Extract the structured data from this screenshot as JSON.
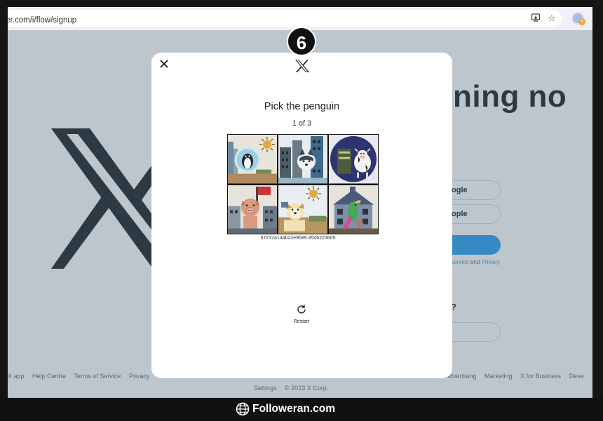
{
  "browser": {
    "url": "ter.com/i/flow/signup",
    "icons": [
      "install-icon",
      "star-icon",
      "extension-icon",
      "menu-icon"
    ],
    "profile_badge": "8"
  },
  "background_page": {
    "headline": "ening no",
    "buttons": [
      "ogle",
      "ople"
    ],
    "terms_prefix": "Service",
    "terms_and": "and",
    "terms_privacy": "Privacy",
    "question": "?",
    "footer_row1": [
      "X app",
      "Help Centre",
      "Terms of Service",
      "Privacy",
      "Advertising",
      "Marketing",
      "X for Business",
      "Deve"
    ],
    "footer_row2": [
      "Settings",
      "© 2023 X Corp."
    ]
  },
  "modal": {
    "title": "Pick the penguin",
    "counter": "1 of 3",
    "hash": "37217a14ab22e9b89.8546223605",
    "restart_label": "Restart",
    "tiles": [
      {
        "name": "tile-penguin"
      },
      {
        "name": "tile-husky-city"
      },
      {
        "name": "tile-cow-planet"
      },
      {
        "name": "tile-pig-flag"
      },
      {
        "name": "tile-dog-sun"
      },
      {
        "name": "tile-parrot-house"
      }
    ]
  },
  "step_badge": "6",
  "watermark": "Followeran.com",
  "colors": {
    "accent": "#1d9bf0",
    "overlay": "#5b7083",
    "text": "#0f1419"
  }
}
